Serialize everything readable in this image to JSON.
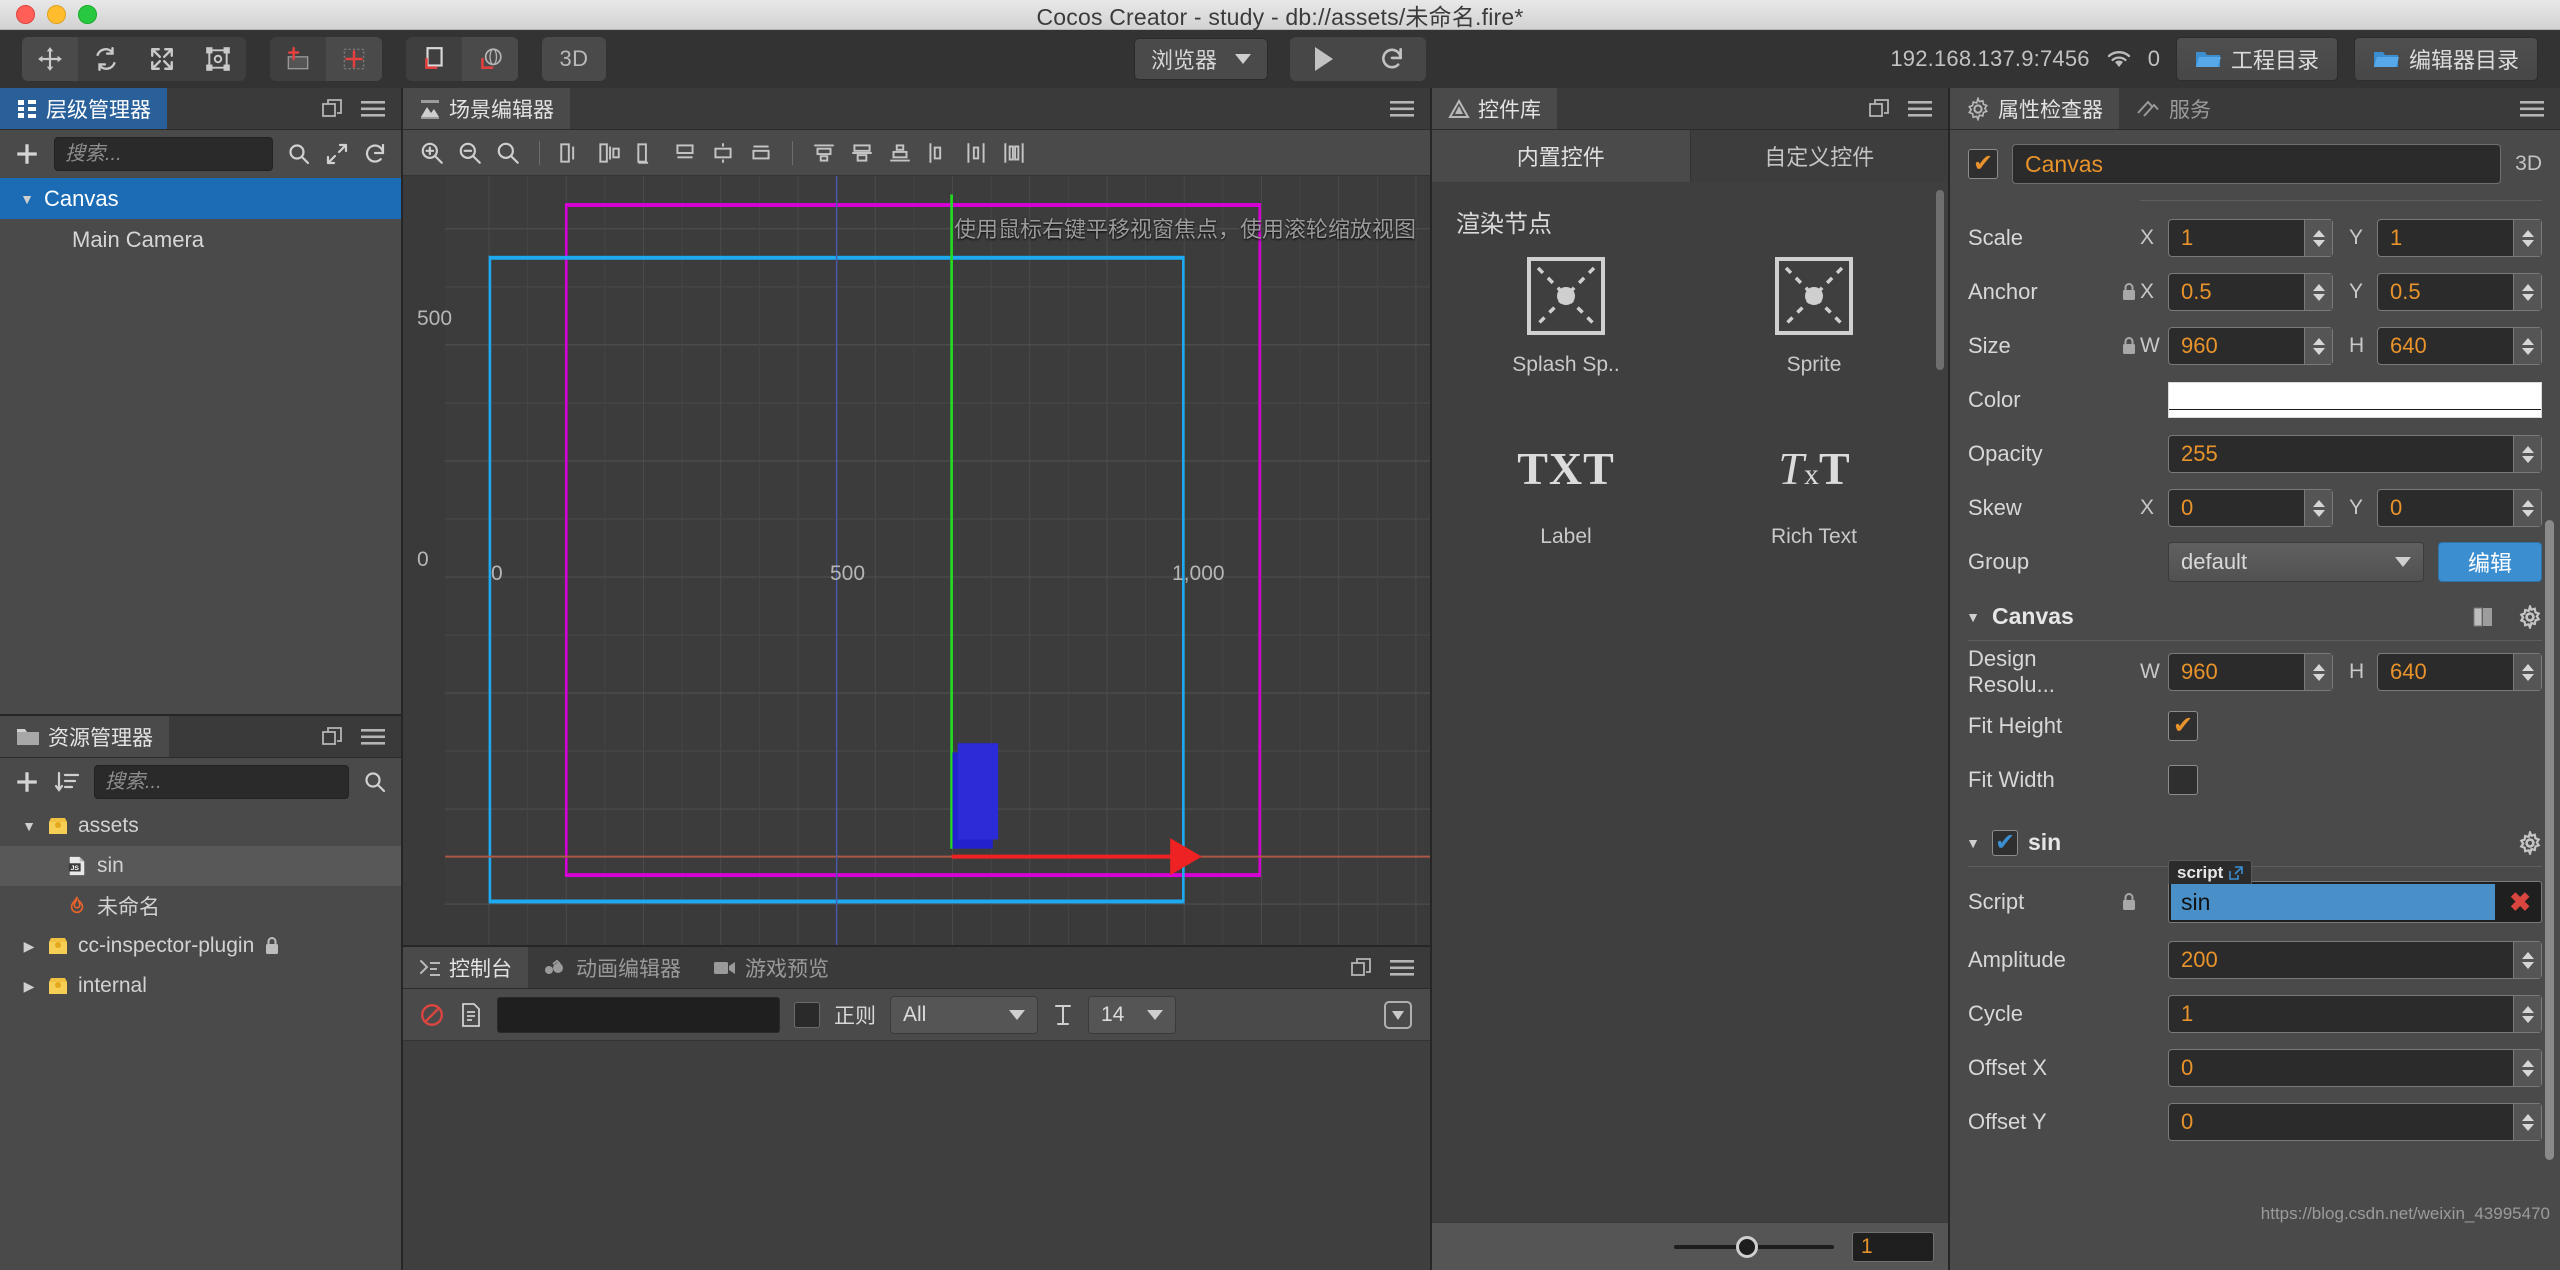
{
  "window": {
    "title": "Cocos Creator - study - db://assets/未命名.fire*"
  },
  "toolbar": {
    "transform_tools": [
      "move-tool",
      "rotate-tool",
      "scale-tool",
      "rect-tool"
    ],
    "align_tools": [
      "pivot-tool",
      "center-tool"
    ],
    "coord_tools": [
      "local-coord-tool",
      "global-coord-tool"
    ],
    "mode_3d_label": "3D",
    "preview_target": "浏览器",
    "play_label": "play",
    "refresh_label": "refresh",
    "ip_address": "192.168.137.9:7456",
    "device_count": "0",
    "project_dir_label": "工程目录",
    "editor_dir_label": "编辑器目录"
  },
  "hierarchy": {
    "tab_label": "层级管理器",
    "search_placeholder": "搜索...",
    "add_label": "+",
    "nodes": [
      {
        "label": "Canvas",
        "indent": 0,
        "expanded": true,
        "selected": true
      },
      {
        "label": "Main Camera",
        "indent": 1,
        "expanded": false,
        "selected": false
      }
    ]
  },
  "assets": {
    "tab_label": "资源管理器",
    "search_placeholder": "搜索...",
    "items": [
      {
        "label": "assets",
        "indent": 0,
        "icon": "folder-icon",
        "arrow": "▼",
        "selected": false,
        "locked": false
      },
      {
        "label": "sin",
        "indent": 1,
        "icon": "js-icon",
        "arrow": "",
        "selected": true,
        "locked": false
      },
      {
        "label": "未命名",
        "indent": 1,
        "icon": "fire-icon",
        "arrow": "",
        "selected": false,
        "locked": false
      },
      {
        "label": "cc-inspector-plugin",
        "indent": 0,
        "icon": "folder-icon",
        "arrow": "▶",
        "selected": false,
        "locked": true
      },
      {
        "label": "internal",
        "indent": 0,
        "icon": "folder-icon",
        "arrow": "▶",
        "selected": false,
        "locked": false
      }
    ]
  },
  "scene": {
    "tab_label": "场景编辑器",
    "hint_text": "使用鼠标右键平移视窗焦点，使用滚轮缩放视图",
    "ruler": {
      "y_labels": [
        "500",
        "0"
      ],
      "x_labels": [
        "0",
        "500",
        "1,000"
      ]
    }
  },
  "console": {
    "tabs": [
      {
        "label": "控制台",
        "active": true
      },
      {
        "label": "动画编辑器",
        "active": false
      },
      {
        "label": "游戏预览",
        "active": false
      }
    ],
    "filter_value": "",
    "regex_label": "正则",
    "level_value": "All",
    "fontsize_value": "14"
  },
  "library": {
    "tab_label": "控件库",
    "tabs": [
      {
        "label": "内置控件",
        "active": true
      },
      {
        "label": "自定义控件",
        "active": false
      }
    ],
    "section_title": "渲染节点",
    "items": [
      {
        "label": "Splash Sp..",
        "icon": "sprite-placeholder-icon"
      },
      {
        "label": "Sprite",
        "icon": "sprite-placeholder-icon"
      },
      {
        "label": "Label",
        "icon": "txt-icon"
      },
      {
        "label": "Rich Text",
        "icon": "rich-text-icon"
      }
    ],
    "zoom_value": "1"
  },
  "inspector": {
    "tabs": [
      {
        "label": "属性检查器",
        "active": true
      },
      {
        "label": "服务",
        "active": false
      }
    ],
    "node_name": "Canvas",
    "node_enabled": true,
    "mode_3d_label": "3D",
    "node_props": [
      {
        "name": "Scale",
        "type": "xy",
        "locked": false,
        "x": "1",
        "y": "1"
      },
      {
        "name": "Anchor",
        "type": "xy",
        "locked": true,
        "x": "0.5",
        "y": "0.5"
      },
      {
        "name": "Size",
        "type": "wh",
        "locked": true,
        "w": "960",
        "h": "640"
      },
      {
        "name": "Color",
        "type": "color",
        "locked": false,
        "value": "#FFFFFF"
      },
      {
        "name": "Opacity",
        "type": "number",
        "locked": false,
        "value": "255"
      },
      {
        "name": "Skew",
        "type": "xy",
        "locked": false,
        "x": "0",
        "y": "0"
      },
      {
        "name": "Group",
        "type": "select",
        "locked": false,
        "value": "default",
        "button": "编辑"
      }
    ],
    "components": [
      {
        "name": "Canvas",
        "enabled": null,
        "collapsed": false,
        "props": [
          {
            "name": "Design Resolu...",
            "type": "wh",
            "w": "960",
            "h": "640"
          },
          {
            "name": "Fit Height",
            "type": "check",
            "checked": true
          },
          {
            "name": "Fit Width",
            "type": "check",
            "checked": false
          }
        ]
      },
      {
        "name": "sin",
        "enabled": true,
        "collapsed": false,
        "props": [
          {
            "name": "Script",
            "type": "script",
            "value": "sin",
            "tag": "script",
            "locked": true
          },
          {
            "name": "Amplitude",
            "type": "number",
            "value": "200"
          },
          {
            "name": "Cycle",
            "type": "number",
            "value": "1"
          },
          {
            "name": "Offset X",
            "type": "number",
            "value": "0"
          },
          {
            "name": "Offset Y",
            "type": "number",
            "value": "0"
          }
        ]
      }
    ],
    "watermark": "https://blog.csdn.net/weixin_43995470"
  },
  "colors": {
    "accent_orange": "#e8932b",
    "accent_blue": "#3b8ed0",
    "select_blue": "#1b6cb5",
    "panel_bg": "#4a4a4a",
    "viewport_bg": "#3c3c3c",
    "canvas_magenta": "#d400d4",
    "camera_cyan": "#1eaaf0",
    "gizmo_green": "#22dd22",
    "gizmo_red": "#ee2222",
    "node_blue": "#2222cc"
  }
}
